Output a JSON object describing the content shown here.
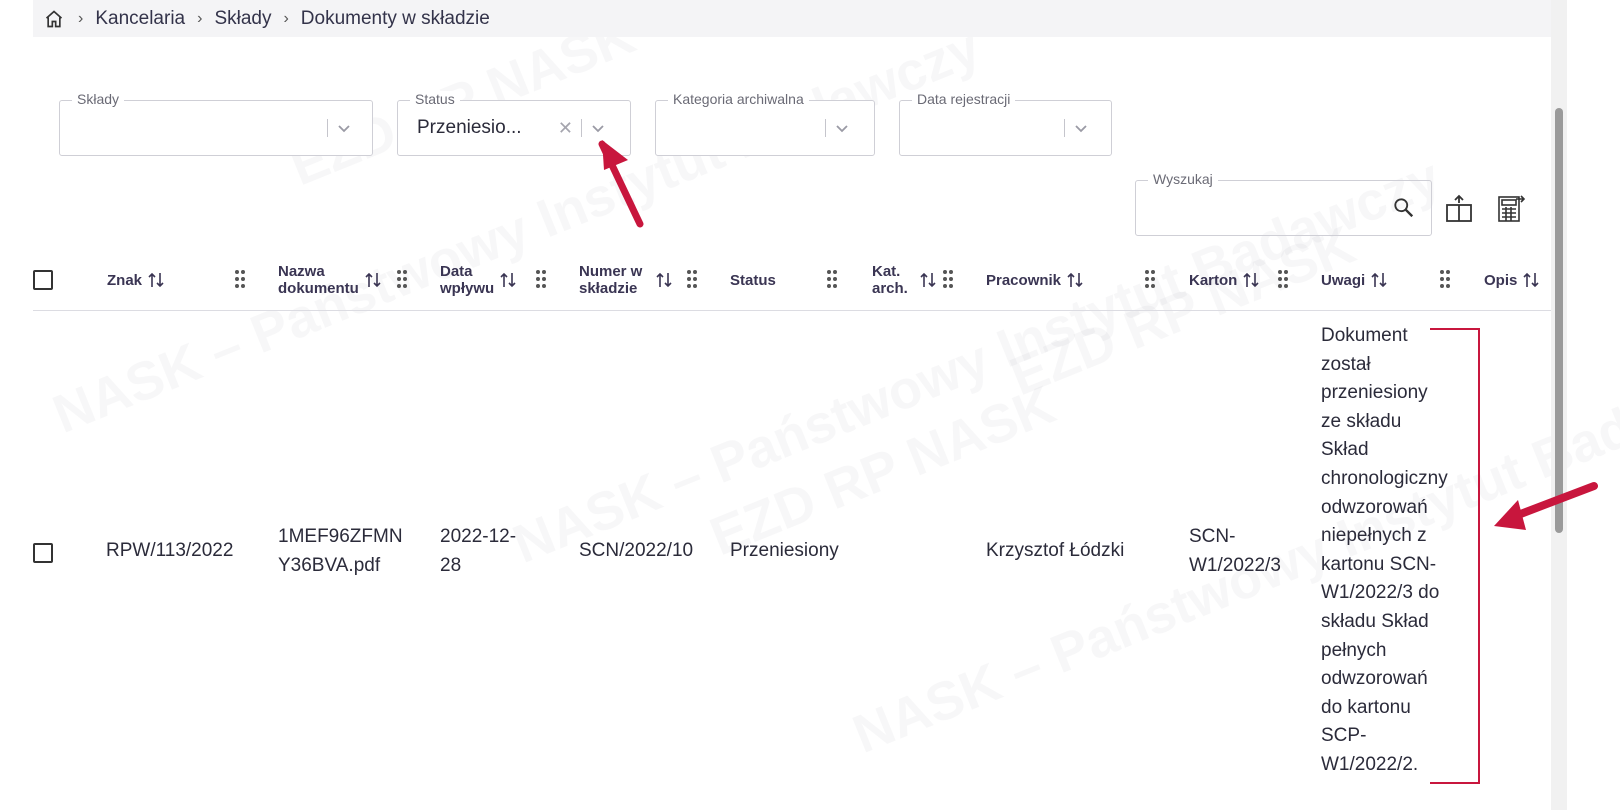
{
  "breadcrumb": {
    "items": [
      "Kancelaria",
      "Składy",
      "Dokumenty w składzie"
    ]
  },
  "filters": {
    "sklady": {
      "label": "Składy",
      "value": ""
    },
    "status": {
      "label": "Status",
      "value": "Przeniesio..."
    },
    "kategoria": {
      "label": "Kategoria archiwalna",
      "value": ""
    },
    "data": {
      "label": "Data rejestracji",
      "value": ""
    }
  },
  "search": {
    "label": "Wyszukaj",
    "value": ""
  },
  "table": {
    "headers": {
      "znak": "Znak",
      "nazwa_1": "Nazwa",
      "nazwa_2": "dokumentu",
      "data_1": "Data",
      "data_2": "wpływu",
      "numer_1": "Numer w",
      "numer_2": "składzie",
      "status": "Status",
      "kat_1": "Kat.",
      "kat_2": "arch.",
      "pracownik": "Pracownik",
      "karton": "Karton",
      "uwagi": "Uwagi",
      "opis": "Opis"
    },
    "row": {
      "znak": "RPW/113/2022",
      "nazwa_1": "1MEF96ZFMN",
      "nazwa_2": "Y36BVA.pdf",
      "data_1": "2022-12-",
      "data_2": "28",
      "numer": "SCN/2022/10",
      "status": "Przeniesiony",
      "pracownik": "Krzysztof Łódzki",
      "karton_1": "SCN-",
      "karton_2": "W1/2022/3",
      "uwagi_lines": [
        "Dokument",
        "został",
        "przeniesiony",
        "ze składu",
        "Skład",
        "chronologiczny",
        "odwzorowań",
        "niepełnych z",
        "kartonu SCN-",
        "W1/2022/3 do",
        "składu Skład",
        "pełnych",
        "odwzorowań",
        "do kartonu",
        "SCP-",
        "W1/2022/2."
      ]
    }
  },
  "watermark": {
    "line_1": "NASK – Państwowy Instytut Badawczy",
    "line_2": "EZD RP NASK"
  },
  "colors": {
    "annotation": "#c8163d",
    "header_text": "#3a3553"
  },
  "icons": [
    "home-icon",
    "chevron-down-icon",
    "clear-icon",
    "search-icon",
    "export-icon",
    "calculator-export-icon",
    "sort-icon",
    "drag-handle-icon"
  ]
}
